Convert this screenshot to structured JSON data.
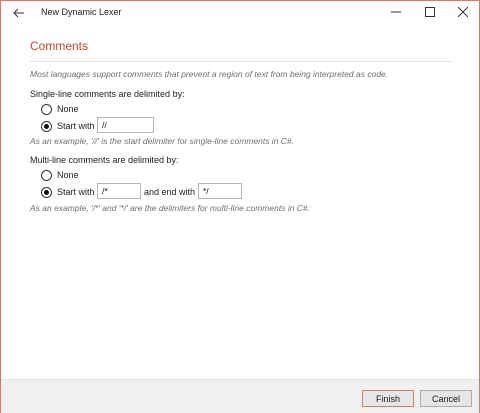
{
  "window": {
    "title": "New Dynamic Lexer"
  },
  "page": {
    "heading": "Comments",
    "description": "Most languages support comments that prevent a region of text from being interpreted as code."
  },
  "single_line": {
    "label": "Single-line comments are delimited by:",
    "option_none": "None",
    "option_start": "Start with",
    "start_value": "//",
    "selected": "start",
    "note": "As an example, '//' is the start delimiter for single-line comments in C#."
  },
  "multi_line": {
    "label": "Multi-line comments are delimited by:",
    "option_none": "None",
    "option_start": "Start with",
    "start_value": "/*",
    "and_end_label": "and end with",
    "end_value": "*/",
    "selected": "start",
    "note": "As an example, '/*' and '*/' are the delimiters for multi-line comments in C#."
  },
  "footer": {
    "finish_label": "Finish",
    "cancel_label": "Cancel"
  },
  "colors": {
    "accent": "#b94a26",
    "border": "#c9816a"
  },
  "icons": {
    "back": "arrow-left-icon",
    "minimize": "minimize-icon",
    "maximize": "maximize-icon",
    "close": "close-icon"
  }
}
